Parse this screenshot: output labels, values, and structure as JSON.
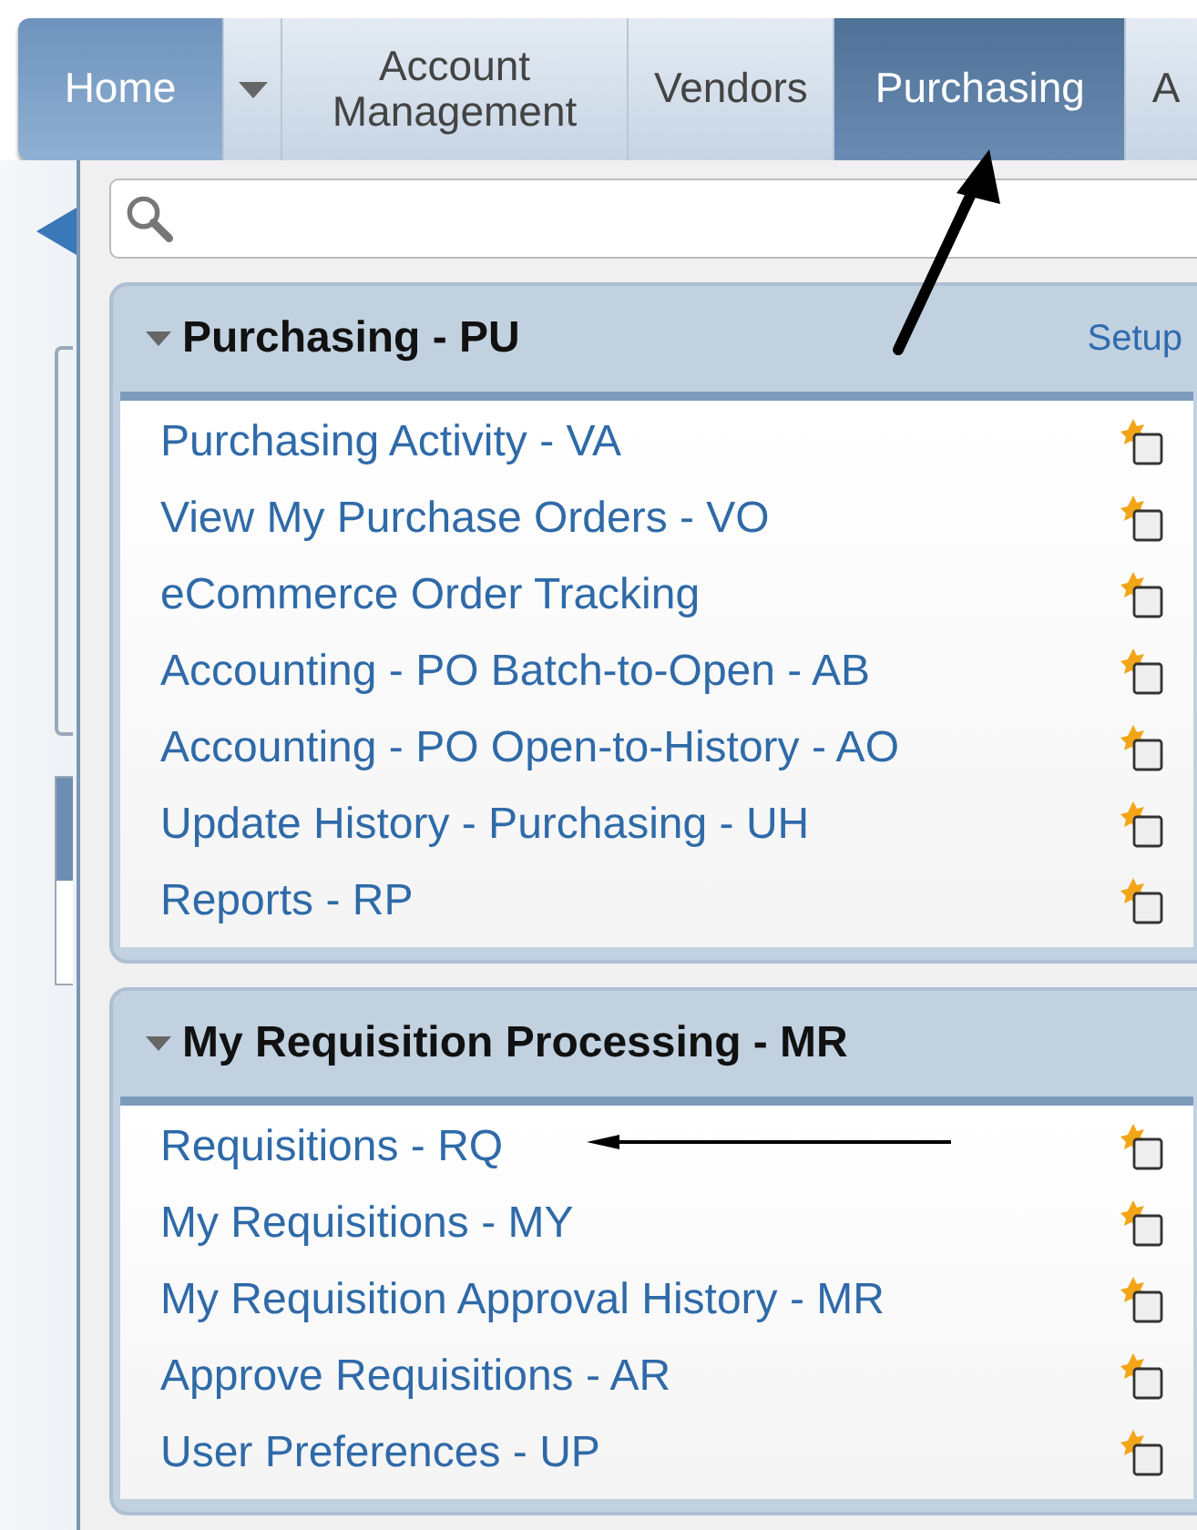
{
  "tabs": [
    {
      "label": "Home",
      "kind": "home",
      "selected": false
    },
    {
      "label": "Account Management",
      "kind": "tab",
      "selected": false
    },
    {
      "label": "Vendors",
      "kind": "tab",
      "selected": false
    },
    {
      "label": "Purchasing",
      "kind": "tab",
      "selected": true
    },
    {
      "label": "A",
      "kind": "tab",
      "selected": false
    }
  ],
  "panels": [
    {
      "title": "Purchasing - PU",
      "expanded": true,
      "setup": "Setup",
      "items": [
        {
          "label": "Purchasing Activity - VA"
        },
        {
          "label": "View My Purchase Orders - VO"
        },
        {
          "label": "eCommerce Order Tracking"
        },
        {
          "label": "Accounting - PO Batch-to-Open - AB"
        },
        {
          "label": "Accounting - PO Open-to-History - AO"
        },
        {
          "label": "Update History - Purchasing - UH"
        },
        {
          "label": "Reports - RP"
        }
      ]
    },
    {
      "title": "My Requisition Processing - MR",
      "expanded": true,
      "items": [
        {
          "label": "Requisitions - RQ"
        },
        {
          "label": "My Requisitions - MY"
        },
        {
          "label": "My Requisition Approval History - MR"
        },
        {
          "label": "Approve Requisitions - AR"
        },
        {
          "label": "User Preferences - UP"
        }
      ]
    }
  ]
}
